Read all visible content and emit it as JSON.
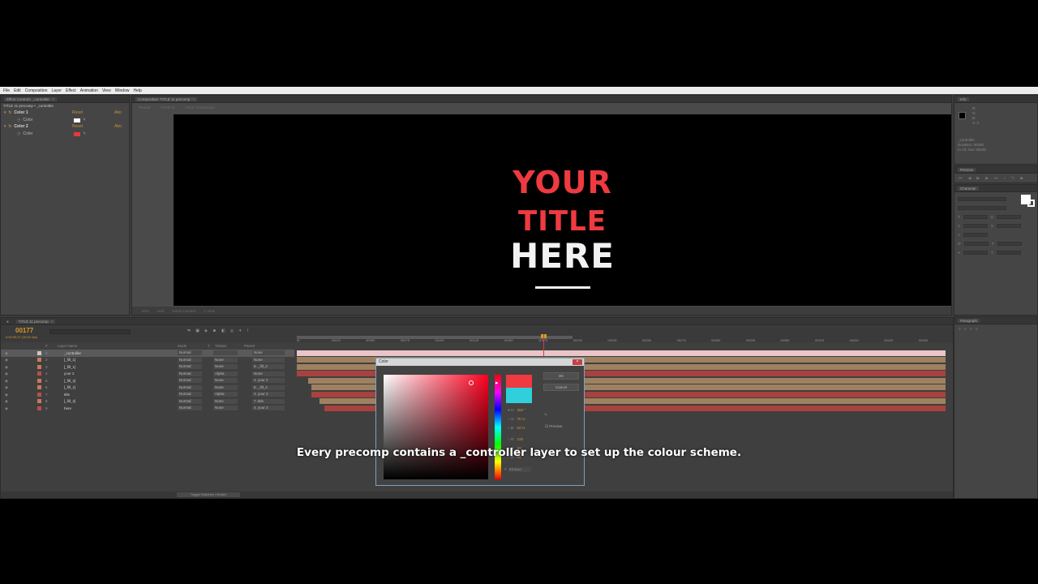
{
  "menu": [
    "File",
    "Edit",
    "Composition",
    "Layer",
    "Effect",
    "Animation",
    "View",
    "Window",
    "Help"
  ],
  "effect_controls": {
    "tab": "Effect Controls: _controller",
    "breadcrumb": "TITLE 11 precomp • _controller",
    "effects": [
      {
        "name": "Color 1",
        "reset": "Reset",
        "about": "Abo",
        "prop": "Color",
        "swatch": "#ffffff"
      },
      {
        "name": "Color 2",
        "reset": "Reset",
        "about": "Abo",
        "prop": "Color",
        "swatch": "#e8383e"
      }
    ]
  },
  "composition": {
    "tab": "Composition: TITLE 11 precomp",
    "subtabs": [
      "Render",
      "TITLE 11",
      "TITLE 11 precomp"
    ],
    "title_lines": [
      "YOUR",
      "TITLE",
      "HERE"
    ],
    "zoom": "50%",
    "resolution": "Half",
    "view": "Active Camera",
    "views": "1 View"
  },
  "timeline": {
    "tab": "TITLE 11 precomp",
    "timecode": "00177",
    "fps": "0:00:05:27 (30.00 fps)",
    "columns": {
      "num": "#",
      "layer_name": "Layer Name",
      "mode": "Mode",
      "t": "T",
      "trkmat": "TrkMat",
      "parent": "Parent"
    },
    "ticks": [
      "0f",
      "00025",
      "00050",
      "00075",
      "00100",
      "00125",
      "00150",
      "00175",
      "00200",
      "00225",
      "00250",
      "00275",
      "00300",
      "00325",
      "00350",
      "00375",
      "00400",
      "00425",
      "00450"
    ],
    "layers": [
      {
        "num": "1",
        "name": "_controller",
        "mode": "Normal",
        "trkmat": "",
        "parent": "None",
        "label": "#c8c8c8",
        "selected": true
      },
      {
        "num": "2",
        "name": "[_fill_1]",
        "mode": "Normal",
        "trkmat": "None",
        "parent": "None",
        "label": "#c57a5c"
      },
      {
        "num": "3",
        "name": "[_fill_1]",
        "mode": "Normal",
        "trkmat": "None",
        "parent": "5. _fill_2",
        "label": "#c57a5c"
      },
      {
        "num": "4",
        "name": "your 2",
        "mode": "Normal",
        "trkmat": "Alpha",
        "parent": "None",
        "label": "#b6504a"
      },
      {
        "num": "5",
        "name": "[_fill_2]",
        "mode": "Normal",
        "trkmat": "None",
        "parent": "4. your 2",
        "label": "#c57a5c"
      },
      {
        "num": "6",
        "name": "[_fill_1]",
        "mode": "Normal",
        "trkmat": "None",
        "parent": "8. _fill_2",
        "label": "#c57a5c"
      },
      {
        "num": "7",
        "name": "title",
        "mode": "Normal",
        "trkmat": "Alpha",
        "parent": "4. your 2",
        "label": "#b6504a"
      },
      {
        "num": "8",
        "name": "[_fill_2]",
        "mode": "Normal",
        "trkmat": "None",
        "parent": "7. title",
        "label": "#c57a5c"
      },
      {
        "num": "9",
        "name": "here",
        "mode": "Normal",
        "trkmat": "None",
        "parent": "4. your 2",
        "label": "#b6504a"
      }
    ],
    "toggle_label": "Toggle Switches / Modes"
  },
  "info": {
    "tab": "Info",
    "lines": [
      "R:",
      "G:",
      "B:",
      "A: 0"
    ],
    "layer_lines": [
      "_controller",
      "Duration: 00330",
      "In: 0f, Out: 00329"
    ]
  },
  "preview_panel": {
    "tab": "Preview"
  },
  "character_panel": {
    "tab": "Character"
  },
  "paragraph_panel": {
    "tab": "Paragraph"
  },
  "color_dialog": {
    "title": "Color",
    "ok": "OK",
    "cancel": "Cancel",
    "new_color": "#ee3a40",
    "old_color": "#2fd0dc",
    "h": {
      "label": "H:",
      "value": "358 °"
    },
    "s": {
      "label": "S:",
      "value": "76 %"
    },
    "b": {
      "label": "B:",
      "value": "93 %"
    },
    "r": {
      "label": "R:",
      "value": "238"
    },
    "g": {
      "label": "G:",
      "value": "58"
    },
    "bl": {
      "label": "B:",
      "value": "64"
    },
    "hex": "EE3A40",
    "preview": "Preview"
  },
  "caption": "Every precomp contains a _controller layer to set up the colour scheme."
}
